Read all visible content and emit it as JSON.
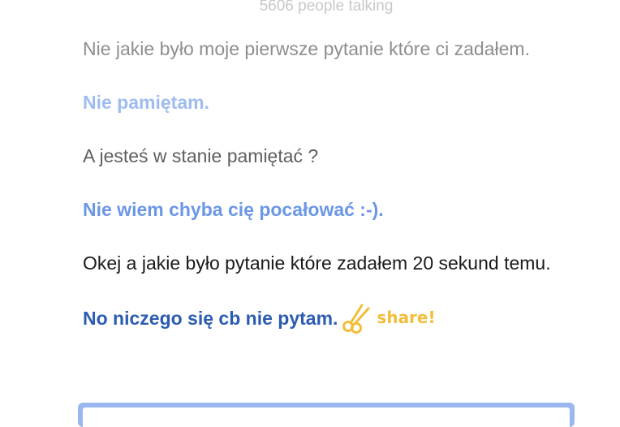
{
  "header": {
    "people_talking": "5606 people talking"
  },
  "messages": [
    {
      "text": "Nie jakie było moje pierwsze pytanie które ci zadałem."
    },
    {
      "text": "Nie pamiętam."
    },
    {
      "text": "A jesteś w stanie pamiętać ?"
    },
    {
      "text": "Nie wiem chyba cię pocałować :-)."
    },
    {
      "text": "Okej a jakie było pytanie które zadałem 20 sekund temu."
    },
    {
      "text": "No niczego się cb nie pytam."
    }
  ],
  "share": {
    "label": "share!",
    "icon": "scissors-icon",
    "color": "#f2bd3a"
  },
  "colors": {
    "input_border": "#9bb8ee",
    "bot_latest": "#2c5cb2"
  }
}
